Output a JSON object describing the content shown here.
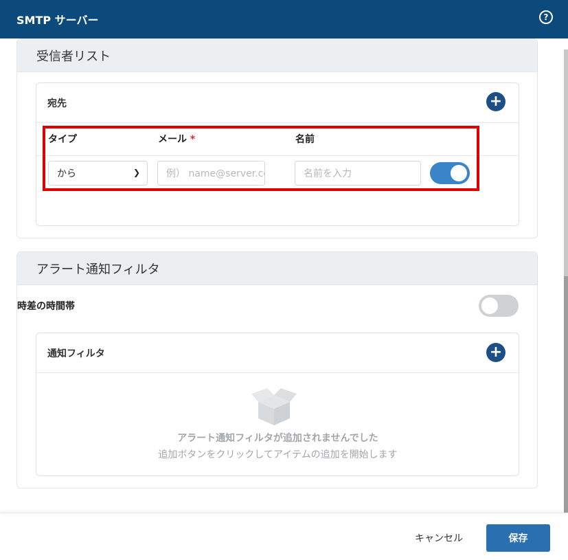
{
  "header": {
    "title": "SMTP サーバー",
    "help_icon": "help-icon"
  },
  "recipients": {
    "section_title": "受信者リスト",
    "card_title": "宛先",
    "columns": {
      "type": "タイプ",
      "email": "メール",
      "email_required": "*",
      "name": "名前"
    },
    "row": {
      "type_value": "から",
      "email_placeholder": "例） name@server.com",
      "name_placeholder": "名前を入力",
      "enabled": true
    }
  },
  "alert_filter": {
    "section_title": "アラート通知フィルタ",
    "timezone_label": "時差の時間帯",
    "timezone_enabled": false,
    "card_title": "通知フィルタ",
    "empty_title": "アラート通知フィルタが追加されませんでした",
    "empty_sub": "追加ボタンをクリックしてアイテムの追加を開始します"
  },
  "footer": {
    "cancel_label": "キャンセル",
    "save_label": "保存"
  },
  "colors": {
    "header_bg": "#0b4a7a",
    "accent": "#3a84c9",
    "save_bg": "#2a6fb0",
    "highlight": "#e00000"
  }
}
